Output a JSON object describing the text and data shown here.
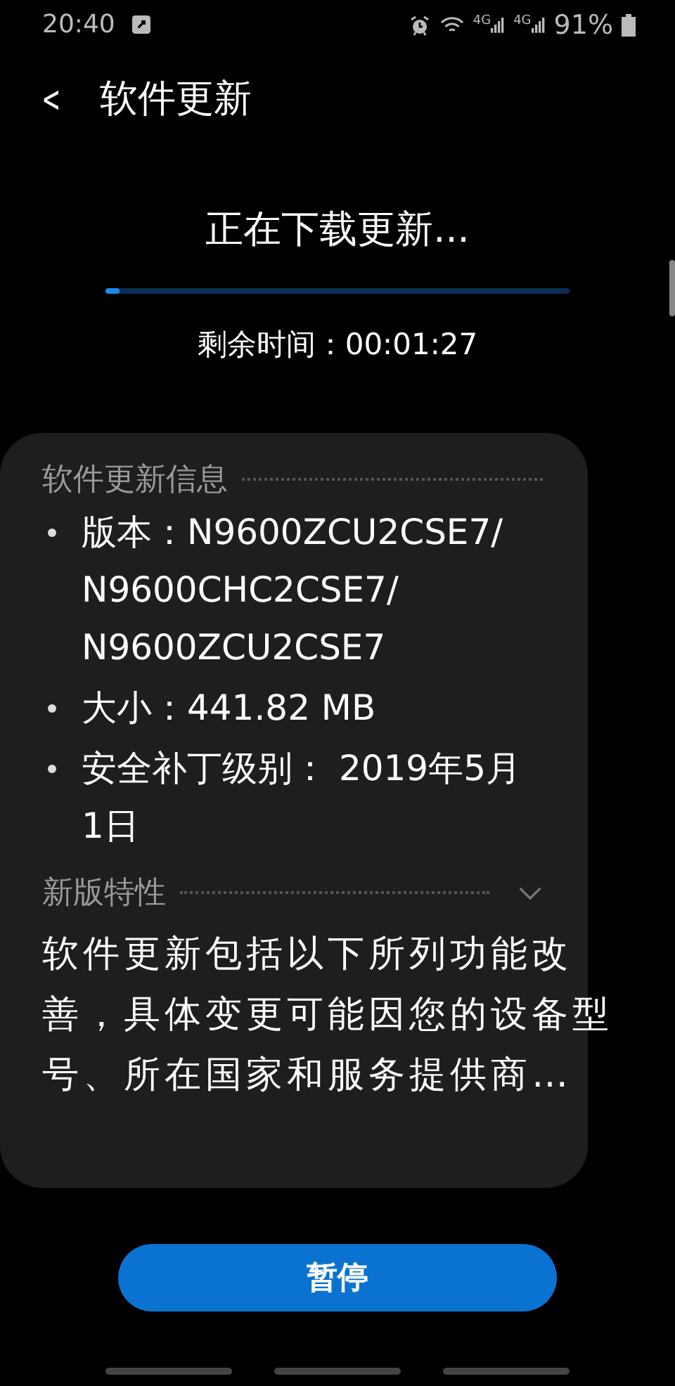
{
  "status_bar": {
    "time": "20:40",
    "signal_labels": [
      "4G",
      "4G"
    ],
    "battery_text": "91%"
  },
  "header": {
    "back": "<",
    "title": "软件更新"
  },
  "download": {
    "status": "正在下载更新...",
    "level": 0.03,
    "remaining": "剩余时间：00:01:27"
  },
  "info": {
    "heading": "软件更新信息",
    "items": [
      {
        "text": "版本：N9600ZCU2CSE7/N9600CHC2CSE7/N9600ZCU2CSE7"
      },
      {
        "text": "大小：441.82 MB"
      },
      {
        "text": "安全补丁级别： 2019年5月1日"
      }
    ]
  },
  "whats_new": {
    "heading": "新版特性",
    "expanded": false,
    "text": "软件更新包括以下所列功能改善，具体变更可能因您的设备型号、所在国家和服务提供商…"
  },
  "buttons": [
    "暂停"
  ]
}
